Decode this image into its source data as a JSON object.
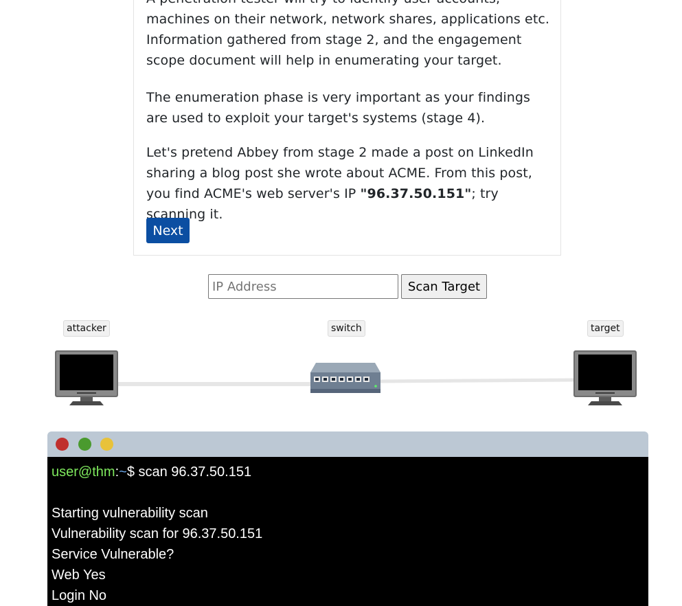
{
  "content": {
    "paragraph1": "A penetration tester will try to identify user accounts, machines on their network, network shares, applications etc. Information gathered from stage 2, and the engagement scope document will help in enumerating your target.",
    "paragraph2": "The enumeration phase is very important as your findings are used to exploit your target's systems (stage 4).",
    "paragraph3_before": "Let's pretend Abbey from stage 2 made a post on LinkedIn sharing a blog post she wrote about ACME. From this post, you find ACME's web server's IP ",
    "paragraph3_bold": "\"96.37.50.151\"",
    "paragraph3_after": "; try scanning it.",
    "next_label": "Next"
  },
  "scan": {
    "placeholder": "IP Address",
    "button_label": "Scan Target"
  },
  "network": {
    "attacker_label": "attacker",
    "switch_label": "switch",
    "target_label": "target",
    "icons": [
      "monitor-icon",
      "network-switch-icon",
      "monitor-icon"
    ]
  },
  "terminal": {
    "window_buttons": [
      "close",
      "minimize",
      "maximize"
    ],
    "colors": {
      "close": "#c0302d",
      "minimize": "#4a9a2e",
      "maximize": "#e8c23a",
      "user": "#7ee85d",
      "path": "#6aa6e8"
    },
    "prompt_user": "user@thm",
    "prompt_sep": ":",
    "prompt_path": "~",
    "prompt_symbol": "$",
    "command": "scan 96.37.50.151",
    "output": [
      "",
      "Starting vulnerability scan",
      "Vulnerability scan for 96.37.50.151",
      "Service Vulnerable?",
      "Web Yes",
      "Login No"
    ]
  }
}
